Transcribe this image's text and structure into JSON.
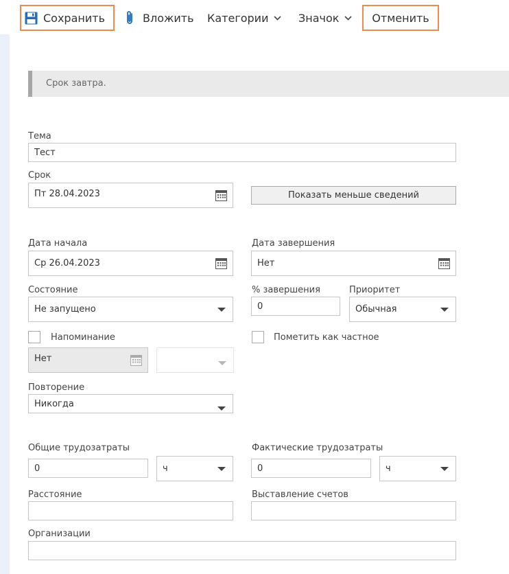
{
  "toolbar": {
    "save_label": "Сохранить",
    "attach_label": "Вложить",
    "categories_label": "Категории",
    "icon_label": "Значок",
    "cancel_label": "Отменить"
  },
  "info": {
    "message": "Срок завтра."
  },
  "form": {
    "subject_label": "Тема",
    "subject_value": "Тест",
    "due_label": "Срок",
    "due_value": "Пт 28.04.2023",
    "show_less_label": "Показать меньше сведений",
    "start_label": "Дата начала",
    "start_value": "Ср 26.04.2023",
    "end_label": "Дата завершения",
    "end_value": "Нет",
    "status_label": "Состояние",
    "status_value": "Не запущено",
    "percent_label": "% завершения",
    "percent_value": "0",
    "priority_label": "Приоритет",
    "priority_value": "Обычная",
    "reminder_label": "Напоминание",
    "reminder_date_value": "Нет",
    "private_label": "Пометить как частное",
    "recurrence_label": "Повторение",
    "recurrence_value": "Никогда",
    "total_work_label": "Общие трудозатраты",
    "total_work_value": "0",
    "total_work_unit": "ч",
    "actual_work_label": "Фактические трудозатраты",
    "actual_work_value": "0",
    "actual_work_unit": "ч",
    "mileage_label": "Расстояние",
    "billing_label": "Выставление счетов",
    "companies_label": "Организации"
  },
  "colors": {
    "highlight_border": "#f08a4b",
    "save_icon": "#1f6dbf",
    "attach_icon": "#1f6dbf",
    "info_bar_bg": "#eaeaea",
    "left_strip": "#eaf1fa"
  }
}
